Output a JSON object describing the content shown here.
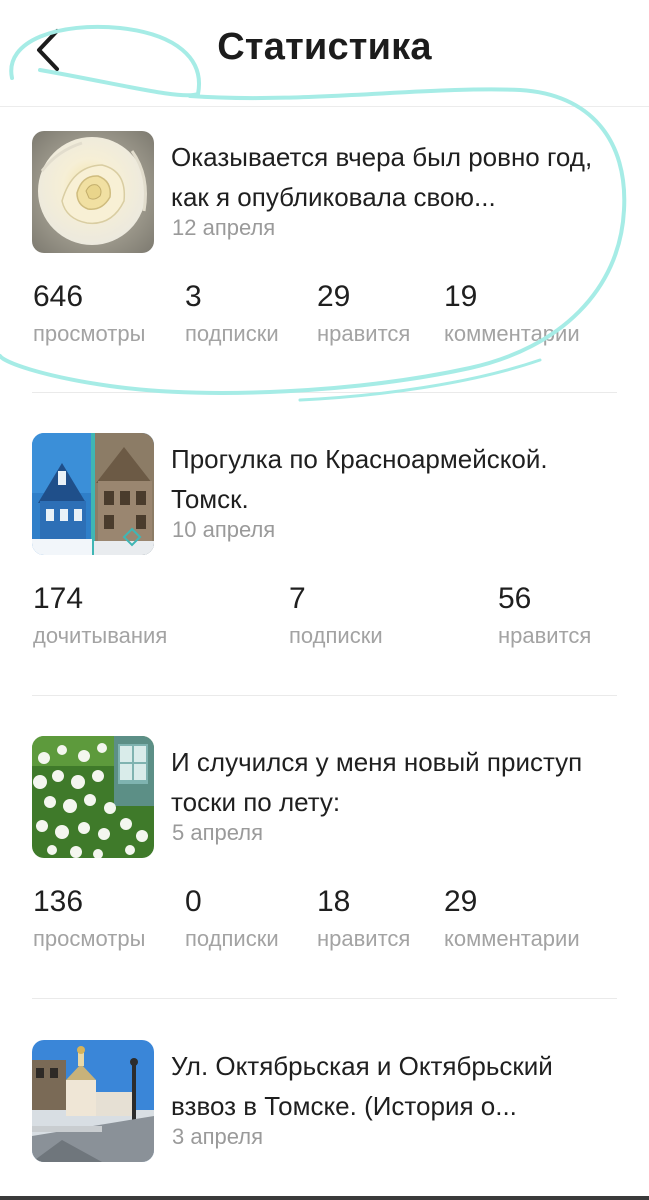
{
  "header": {
    "title": "Статистика",
    "back_icon": "chevron-left-icon"
  },
  "colors": {
    "text": "#1f1f1f",
    "muted": "#a3a3a3",
    "scribble": "#a6ece6"
  },
  "posts": [
    {
      "title": "Оказывается вчера был ровно год, как я опубликовала свою...",
      "date": "12 апреля",
      "thumbnail": "white-rose-image",
      "stats": [
        {
          "value": "646",
          "label": "просмотры"
        },
        {
          "value": "3",
          "label": "подписки"
        },
        {
          "value": "29",
          "label": "нравится"
        },
        {
          "value": "19",
          "label": "комментарии"
        }
      ]
    },
    {
      "title": "Прогулка по Красноармейской. Томск.",
      "date": "10 апреля",
      "thumbnail": "wooden-houses-image",
      "stats": [
        {
          "value": "174",
          "label": "дочитывания"
        },
        {
          "value": "7",
          "label": "подписки"
        },
        {
          "value": "56",
          "label": "нравится"
        }
      ]
    },
    {
      "title": "И случился у меня новый приступ тоски по лету:",
      "date": "5 апреля",
      "thumbnail": "white-flowers-bush-image",
      "stats": [
        {
          "value": "136",
          "label": "просмотры"
        },
        {
          "value": "0",
          "label": "подписки"
        },
        {
          "value": "18",
          "label": "нравится"
        },
        {
          "value": "29",
          "label": "комментарии"
        }
      ]
    },
    {
      "title": "Ул. Октябрьская и Октябрьский взвоз в Томске. (История о...",
      "date": "3 апреля",
      "thumbnail": "street-church-image"
    }
  ]
}
